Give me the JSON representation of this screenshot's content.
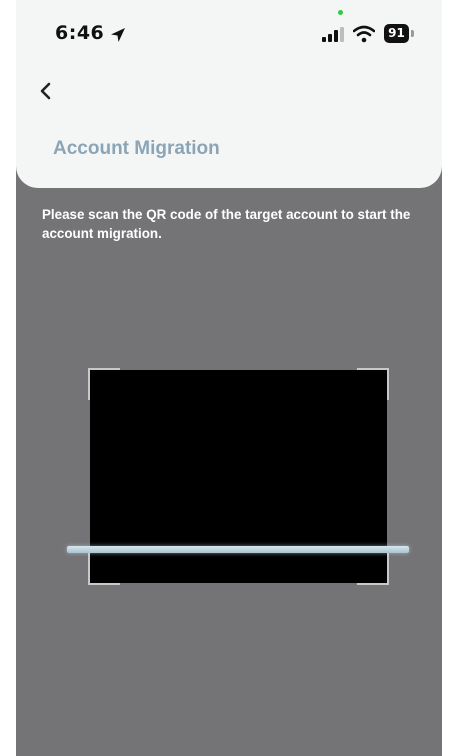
{
  "status_bar": {
    "time": "6:46",
    "battery_level": "91",
    "icons": [
      "location-arrow-icon",
      "signal-icon",
      "wifi-icon",
      "battery-icon"
    ]
  },
  "header": {
    "back_icon": "chevron-left-icon",
    "title": "Account Migration"
  },
  "instruction": "Please scan the QR code of the target account to start the account migration.",
  "colors": {
    "background": "#747477",
    "header_bg": "#f4f6f6",
    "title_color": "#8ca5b6",
    "scan_line": "#c4d8e0",
    "viewfinder": "#000000"
  }
}
